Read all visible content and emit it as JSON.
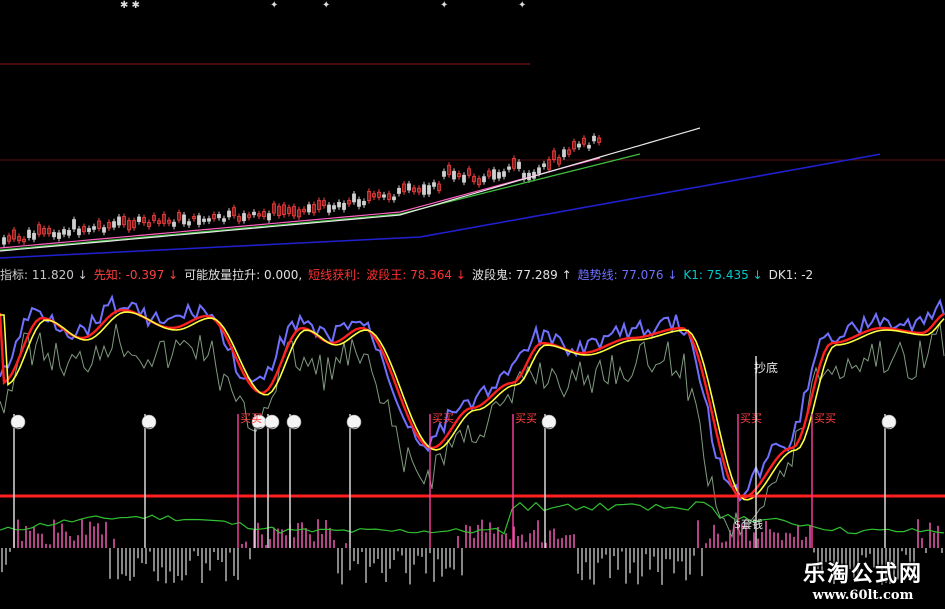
{
  "top_markers": [
    "✱ ✱",
    "✦",
    "✦",
    "✦",
    "✦"
  ],
  "indicator_bar": {
    "items": [
      {
        "text": "指标: 11.820 ↓",
        "color": "#c8c8c8"
      },
      {
        "text": "先知: -0.397 ↓",
        "color": "#ff4040"
      },
      {
        "text": "可能放量拉升: 0.000,",
        "color": "#e0e0e0"
      },
      {
        "text": "短线获利:",
        "color": "#ff3030"
      },
      {
        "text": "波段王: 78.364 ↓",
        "color": "#ff3030"
      },
      {
        "text": "波段鬼: 77.289 ↑",
        "color": "#e0e0e0"
      },
      {
        "text": "趋势线: 77.076 ↓",
        "color": "#6f6fff"
      },
      {
        "text": "K1: 75.435 ↓",
        "color": "#00c8c8"
      },
      {
        "text": "DK1: -2",
        "color": "#e0e0e0"
      }
    ]
  },
  "signals": {
    "buy_label": "买买",
    "bottom_label": "抄底",
    "money_label": "$套钱",
    "emoji": "☺"
  },
  "watermark": {
    "name": "乐淘公式网",
    "url": "www.60lt.com"
  },
  "colors": {
    "background": "#000000",
    "up_candle": "#ff4040",
    "down_candle": "#d0d0d0",
    "ma_blue": "#2020d0",
    "ma_white": "#e8e8e8",
    "ma_green": "#40c040",
    "ma_pink": "#ff60c0",
    "line_blue": "#7070ff",
    "line_red": "#ff2020",
    "line_yellow": "#ffff40",
    "line_gray_green": "#809a80",
    "threshold_red": "#ff2020",
    "histogram_up": "#ff60c0",
    "histogram_down": "#c0c0c0"
  }
}
